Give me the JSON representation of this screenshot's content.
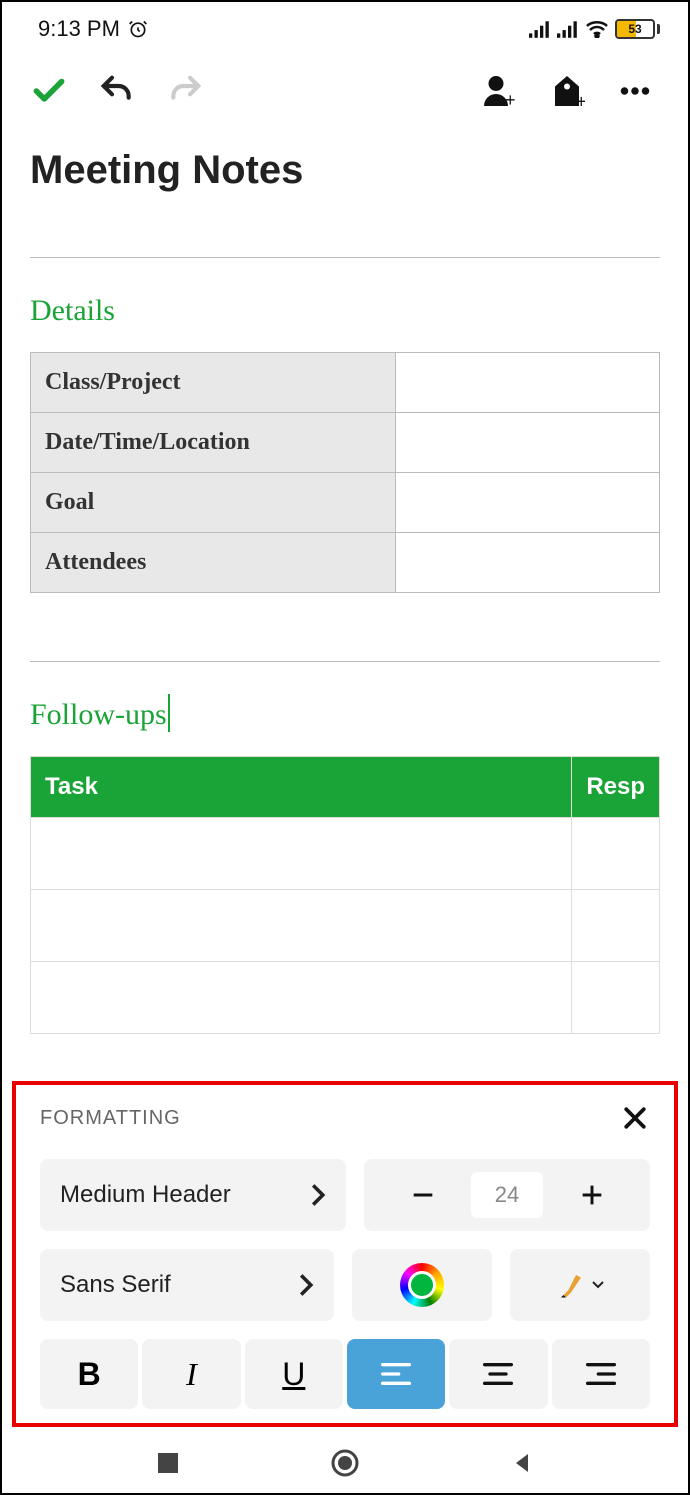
{
  "status": {
    "time": "9:13 PM",
    "battery": "53"
  },
  "note": {
    "title": "Meeting Notes",
    "sections": {
      "details": {
        "heading": "Details",
        "rows": [
          "Class/Project",
          "Date/Time/Location",
          "Goal",
          "Attendees"
        ]
      },
      "followups": {
        "heading": "Follow-ups",
        "columns": [
          "Task",
          "Resp"
        ]
      }
    }
  },
  "formatting": {
    "title": "FORMATTING",
    "style_label": "Medium Header",
    "font_label": "Sans Serif",
    "font_size": "24"
  }
}
